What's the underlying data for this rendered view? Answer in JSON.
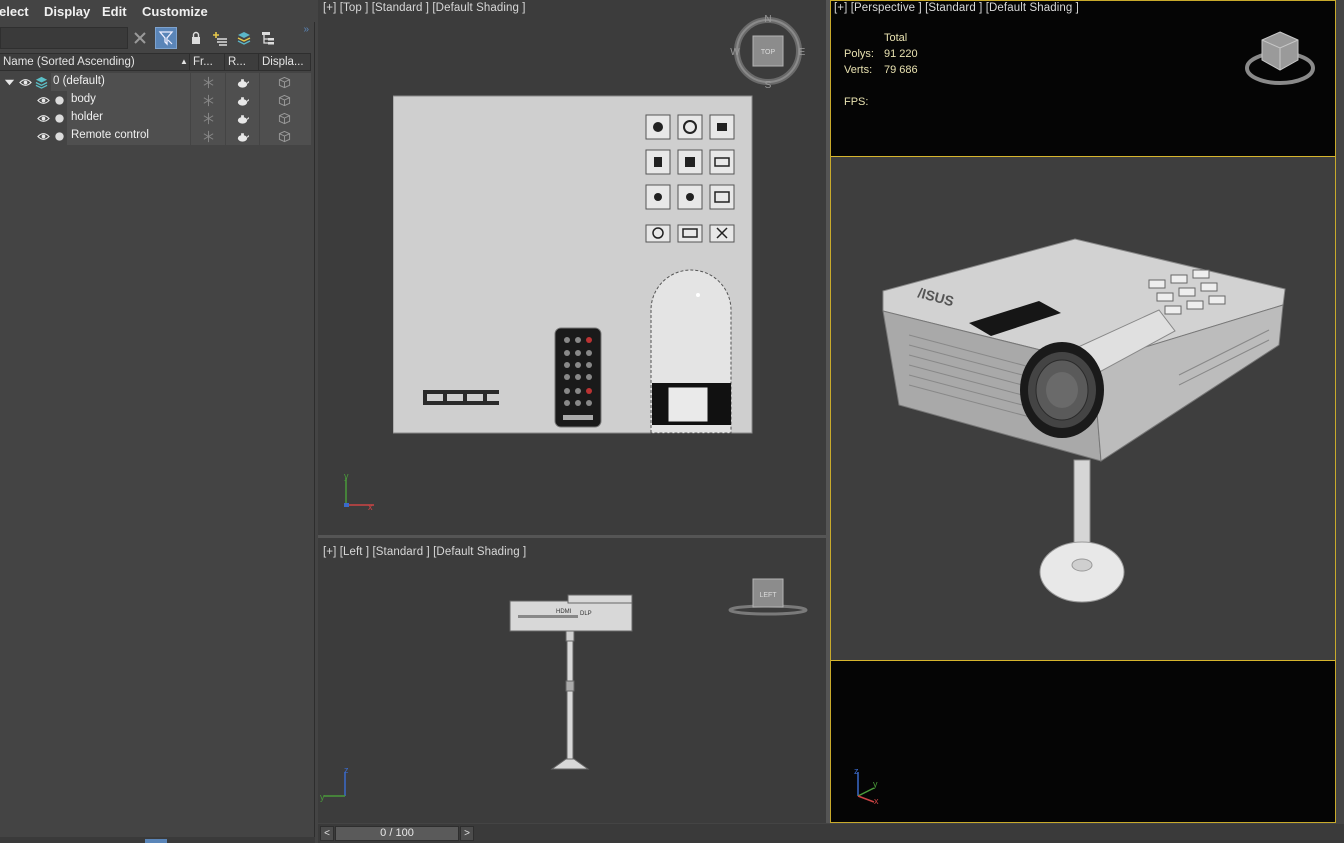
{
  "menu": {
    "items": [
      "elect",
      "Display",
      "Edit",
      "Customize"
    ]
  },
  "explorer": {
    "search_placeholder": "",
    "columns": {
      "name": "Name (Sorted Ascending)",
      "frozen": "Fr...",
      "renderable": "R...",
      "display": "Displa..."
    },
    "layer": {
      "label": "0 (default)"
    },
    "objects": [
      {
        "label": "body"
      },
      {
        "label": "holder"
      },
      {
        "label": "Remote control"
      }
    ]
  },
  "viewports": {
    "top": {
      "label": "[+] [Top ] [Standard ] [Default Shading ]",
      "viewcube": {
        "n": "N",
        "s": "S",
        "e": "E",
        "w": "W",
        "face": "TOP"
      },
      "axis": {
        "x": "x",
        "y": "y"
      }
    },
    "left": {
      "label": "[+] [Left ] [Standard ] [Default Shading ]",
      "viewcube": {
        "face": "LEFT"
      },
      "axis": {
        "y": "y",
        "z": "z"
      }
    },
    "perspective": {
      "label": "[+] [Perspective ] [Standard ] [Default Shading ]",
      "stats": {
        "header": "Total",
        "polys_label": "Polys:",
        "polys_value": "91 220",
        "verts_label": "Verts:",
        "verts_value": "79 686",
        "fps_label": "FPS:"
      },
      "axis": {
        "x": "x",
        "y": "y",
        "z": "z"
      }
    }
  },
  "timeline": {
    "prev": "<",
    "next": ">",
    "frame": "0 / 100"
  },
  "colors": {
    "selection_border": "#d7b62e",
    "accent_blue": "#5a85b8",
    "stats_text": "#e8e1b0"
  },
  "icons": [
    "close-icon",
    "filter-icon",
    "lock-icon",
    "add-layer-icon",
    "layers-icon",
    "hierarchy-icon",
    "eye-icon",
    "snowflake-icon",
    "teapot-icon",
    "box-icon"
  ]
}
